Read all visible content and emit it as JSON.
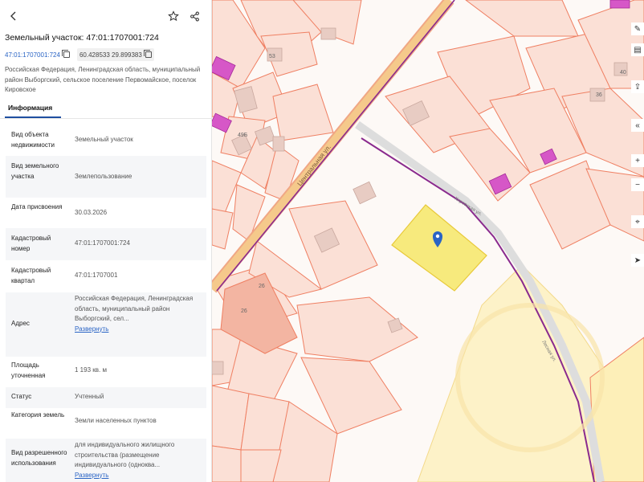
{
  "parcel": {
    "title": "Земельный участок: 47:01:1707001:724",
    "cadastral_number": "47:01:1707001:724",
    "coordinates": "60.428533 29.899383",
    "address_line": "Российская Федерация, Ленинградская область, муниципальный район Выборгский, сельское поселение Первомайское, поселок Кировское"
  },
  "tabs": [
    "Информация"
  ],
  "info_rows": [
    {
      "label": "Вид объекта недвижимости",
      "value": "Земельный участок"
    },
    {
      "label": "Вид земельного участка",
      "value": "Землепользование"
    },
    {
      "label": "Дата присвоения",
      "value": "30.03.2026"
    },
    {
      "label": "Кадастровый номер",
      "value": "47:01:1707001:724"
    },
    {
      "label": "Кадастровый квартал",
      "value": "47:01:1707001"
    },
    {
      "label": "Адрес",
      "value": "Российская Федерация, Ленинградская область, муниципальный район Выборгский, сел...",
      "link": "Развернуть"
    },
    {
      "label": "Площадь уточненная",
      "value": "1 193 кв. м"
    },
    {
      "label": "Статус",
      "value": "Учтенный"
    },
    {
      "label": "Категория земель",
      "value": "Земли населенных пунктов"
    },
    {
      "label": "Вид разрешенного использования",
      "value": "для индивидуального жилищного строительства (размещение индивидуального (одноква...",
      "link": "Развернуть"
    }
  ],
  "map": {
    "street_central": "Центральная ул.",
    "street_cross": "Кировская ул.",
    "street_bottom": "Лесная ул.",
    "house_labels": [
      "53",
      "40",
      "36",
      "49Б",
      "26",
      "26"
    ],
    "colors": {
      "parcel_border": "#ef7f62",
      "parcel_fill": "#fbe0d6",
      "selected_fill": "#f7ea7d",
      "selected_border": "#e8c93a",
      "yellow_zone": "#fdf2c8",
      "road": "#f5c98b",
      "border_line": "#8a2a8e",
      "building": "#e8ccc3",
      "purple_building": "#d657c7",
      "pin": "#2a64c5"
    }
  },
  "icons": {
    "back": "chevron-left-icon",
    "favorite": "star-icon",
    "share": "share-icon",
    "copy": "copy-icon",
    "pin": "location-pin-icon"
  }
}
